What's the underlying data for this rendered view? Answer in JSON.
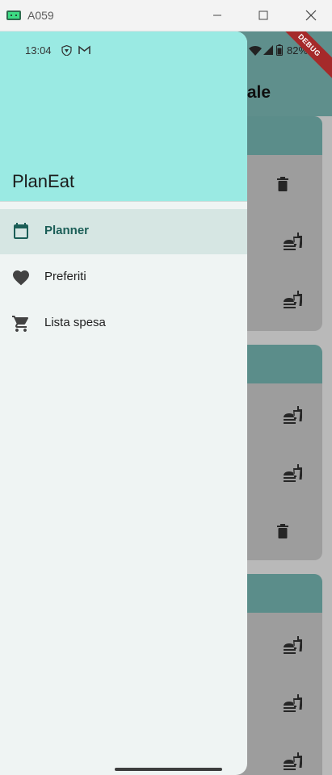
{
  "window": {
    "title": "A059"
  },
  "status_bar": {
    "time": "13:04",
    "battery": "82%"
  },
  "debug_banner": "DEBUG",
  "background": {
    "title_fragment": "nale"
  },
  "drawer": {
    "title": "PlanEat",
    "items": [
      {
        "label": "Planner",
        "icon": "calendar-icon",
        "selected": true
      },
      {
        "label": "Preferiti",
        "icon": "heart-icon",
        "selected": false
      },
      {
        "label": "Lista spesa",
        "icon": "cart-icon",
        "selected": false
      }
    ]
  },
  "colors": {
    "drawer_header": "#9aeae3",
    "drawer_body": "#eff4f3",
    "selected_item": "#d6e6e3",
    "accent": "#1b5e57",
    "debug_ribbon": "#a52a2a"
  }
}
